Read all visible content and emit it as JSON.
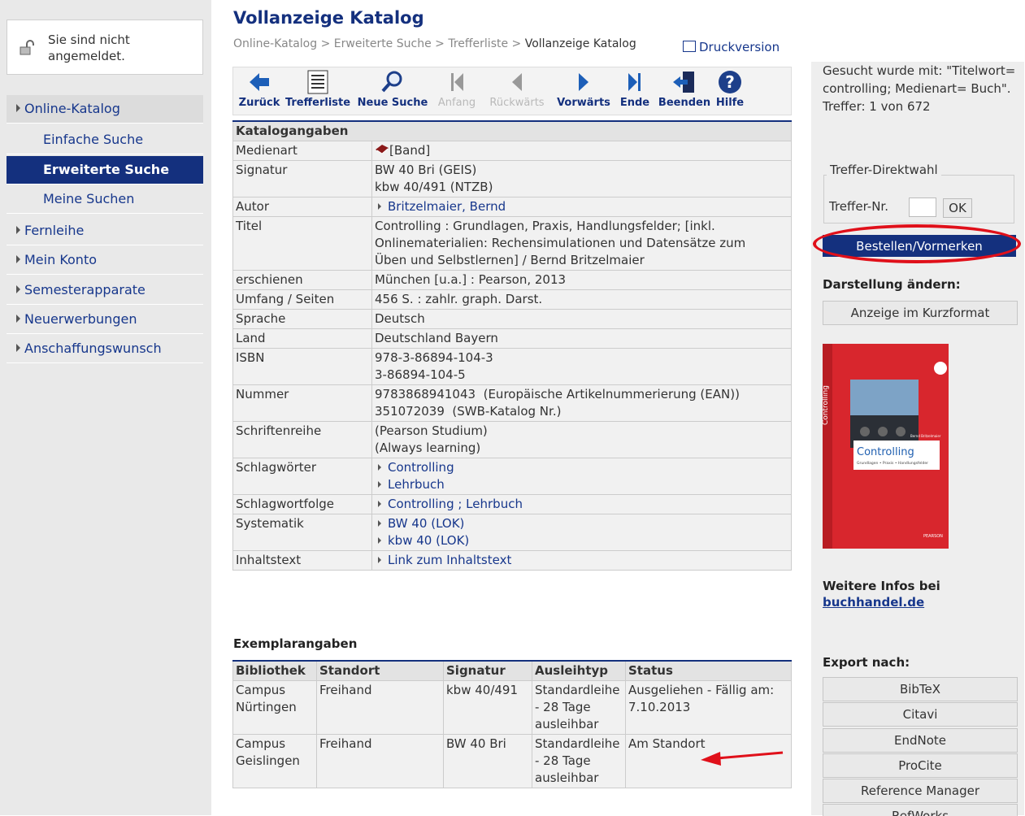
{
  "sidebar": {
    "login_text": "Sie sind nicht angemeldet.",
    "items": [
      {
        "label": "Online-Katalog"
      },
      {
        "label": "Einfache Suche"
      },
      {
        "label": "Erweiterte Suche"
      },
      {
        "label": "Meine Suchen"
      },
      {
        "label": "Fernleihe"
      },
      {
        "label": "Mein Konto"
      },
      {
        "label": "Semesterapparate"
      },
      {
        "label": "Neuerwerbungen"
      },
      {
        "label": "Anschaffungswunsch"
      }
    ]
  },
  "header": {
    "title": "Vollanzeige Katalog",
    "breadcrumb": [
      "Online-Katalog",
      "Erweiterte Suche",
      "Trefferliste",
      "Vollanzeige Katalog"
    ],
    "separator": ">",
    "print_label": "Druckversion"
  },
  "toolbar": [
    "Zurück",
    "Trefferliste",
    "Neue Suche",
    "Anfang",
    "Rückwärts",
    "Vorwärts",
    "Ende",
    "Beenden",
    "Hilfe"
  ],
  "catalog": {
    "heading": "Katalogangaben",
    "rows": [
      {
        "key": "Medienart",
        "lines": [
          "[Band]"
        ]
      },
      {
        "key": "Signatur",
        "lines": [
          "BW 40 Bri (GEIS)",
          "kbw 40/491 (NTZB)"
        ]
      },
      {
        "key": "Autor",
        "links": [
          "Britzelmaier, Bernd"
        ]
      },
      {
        "key": "Titel",
        "lines": [
          "Controlling : Grundlagen, Praxis, Handlungsfelder; [inkl.",
          "Onlinematerialien: Rechensimulationen und Datensätze zum",
          "Üben und Selbstlernen] / Bernd Britzelmaier"
        ]
      },
      {
        "key": "erschienen",
        "lines": [
          "München [u.a.] : Pearson, 2013"
        ]
      },
      {
        "key": "Umfang / Seiten",
        "lines": [
          "456 S. : zahlr. graph. Darst."
        ]
      },
      {
        "key": "Sprache",
        "lines": [
          "Deutsch"
        ]
      },
      {
        "key": "Land",
        "lines": [
          "Deutschland Bayern"
        ]
      },
      {
        "key": "ISBN",
        "lines": [
          "978-3-86894-104-3",
          "3-86894-104-5"
        ]
      },
      {
        "key": "Nummer",
        "lines": [
          "9783868941043  (Europäische Artikelnummerierung (EAN))",
          "351072039  (SWB-Katalog Nr.)"
        ]
      },
      {
        "key": "Schriftenreihe",
        "lines": [
          "(Pearson Studium)",
          "(Always learning)"
        ]
      },
      {
        "key": "Schlagwörter",
        "links": [
          "Controlling",
          "Lehrbuch"
        ]
      },
      {
        "key": "Schlagwortfolge",
        "links": [
          "Controlling ; Lehrbuch"
        ]
      },
      {
        "key": "Systematik",
        "links": [
          "BW 40 (LOK)",
          "kbw 40 (LOK)"
        ]
      },
      {
        "key": "Inhaltstext",
        "links": [
          "Link zum Inhaltstext"
        ]
      }
    ]
  },
  "copies": {
    "heading": "Exemplarangaben",
    "columns": [
      "Bibliothek",
      "Standort",
      "Signatur",
      "Ausleihtyp",
      "Status"
    ],
    "rows": [
      [
        "Campus Nürtingen",
        "Freihand",
        "kbw 40/491",
        "Standardleihe - 28 Tage ausleihbar",
        "Ausgeliehen - Fällig am: 7.10.2013"
      ],
      [
        "Campus Geislingen",
        "Freihand",
        "BW 40 Bri",
        "Standardleihe - 28 Tage ausleihbar",
        "Am Standort"
      ]
    ]
  },
  "right": {
    "search_info": "Gesucht wurde mit: \"Titelwort= controlling; Medienart= Buch\". Treffer: 1 von 672",
    "direktwahl_legend": "Treffer-Direktwahl",
    "direktwahl_label": "Treffer-Nr.",
    "direktwahl_value": "",
    "ok_label": "OK",
    "order_label": "Bestellen/Vormerken",
    "display_heading": "Darstellung ändern:",
    "short_format_label": "Anzeige im Kurzformat",
    "cover": {
      "spine": "Controlling",
      "title": "Controlling",
      "subtitle": "Grundlagen • Praxis • Handlungsfelder",
      "author": "Bernd Britzelmaier",
      "publisher": "PEARSON"
    },
    "more_info_heading": "Weitere Infos bei",
    "more_info_link": "buchhandel.de",
    "export_heading": "Export nach:",
    "export_items": [
      "BibTeX",
      "Citavi",
      "EndNote",
      "ProCite",
      "Reference Manager",
      "RefWorks"
    ]
  },
  "colors": {
    "accent": "#14307e",
    "highlight": "#e0101a",
    "link": "#17378c",
    "book_cover": "#d8262d"
  }
}
